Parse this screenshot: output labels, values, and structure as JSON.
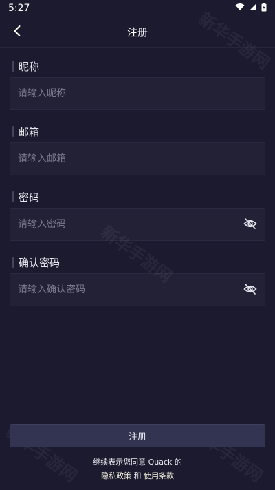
{
  "status_bar": {
    "time": "5:27",
    "icons": [
      "wifi-icon",
      "signal-icon",
      "battery-icon"
    ]
  },
  "app_bar": {
    "title": "注册",
    "back_icon": "chevron-left-icon"
  },
  "form": {
    "nickname": {
      "label": "昵称",
      "placeholder": "请输入昵称",
      "value": ""
    },
    "email": {
      "label": "邮箱",
      "placeholder": "请输入邮箱",
      "value": ""
    },
    "password": {
      "label": "密码",
      "placeholder": "请输入密码",
      "value": "",
      "toggle_icon": "eye-off-icon"
    },
    "confirm_password": {
      "label": "确认密码",
      "placeholder": "请输入确认密码",
      "value": "",
      "toggle_icon": "eye-off-icon"
    }
  },
  "actions": {
    "register_label": "注册"
  },
  "agreement": {
    "line1": "继续表示您同意 Quack 的",
    "privacy_link": "隐私政策",
    "conjunction": " 和 ",
    "terms_link": "使用条款"
  },
  "watermark": {
    "text": "新华手游网"
  },
  "colors": {
    "background": "#1b1a2e",
    "input_background": "#222136",
    "button_background": "#333352",
    "placeholder": "#7b7a8c",
    "link": "#f1efdc"
  }
}
